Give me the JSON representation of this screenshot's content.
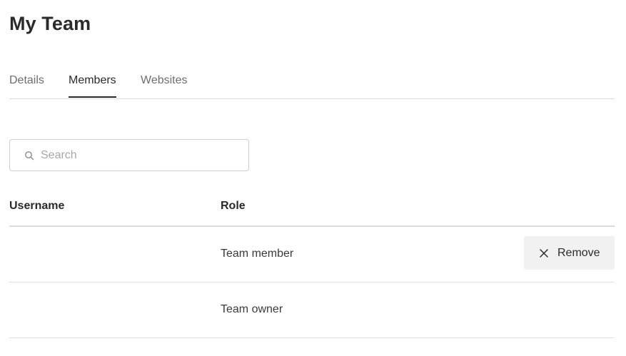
{
  "page": {
    "title": "My Team"
  },
  "tabs": [
    {
      "label": "Details",
      "active": false
    },
    {
      "label": "Members",
      "active": true
    },
    {
      "label": "Websites",
      "active": false
    }
  ],
  "search": {
    "placeholder": "Search",
    "value": "",
    "icon": "search-icon"
  },
  "table": {
    "columns": [
      "Username",
      "Role"
    ],
    "rows": [
      {
        "username": "",
        "role": "Team member",
        "action": {
          "label": "Remove",
          "icon": "close-icon"
        }
      },
      {
        "username": "",
        "role": "Team owner"
      }
    ]
  },
  "colors": {
    "text": "#2a2a2a",
    "muted_tab": "#6e6e6e",
    "remove_button_bg": "#f1f1f1",
    "divider": "#dadada"
  }
}
